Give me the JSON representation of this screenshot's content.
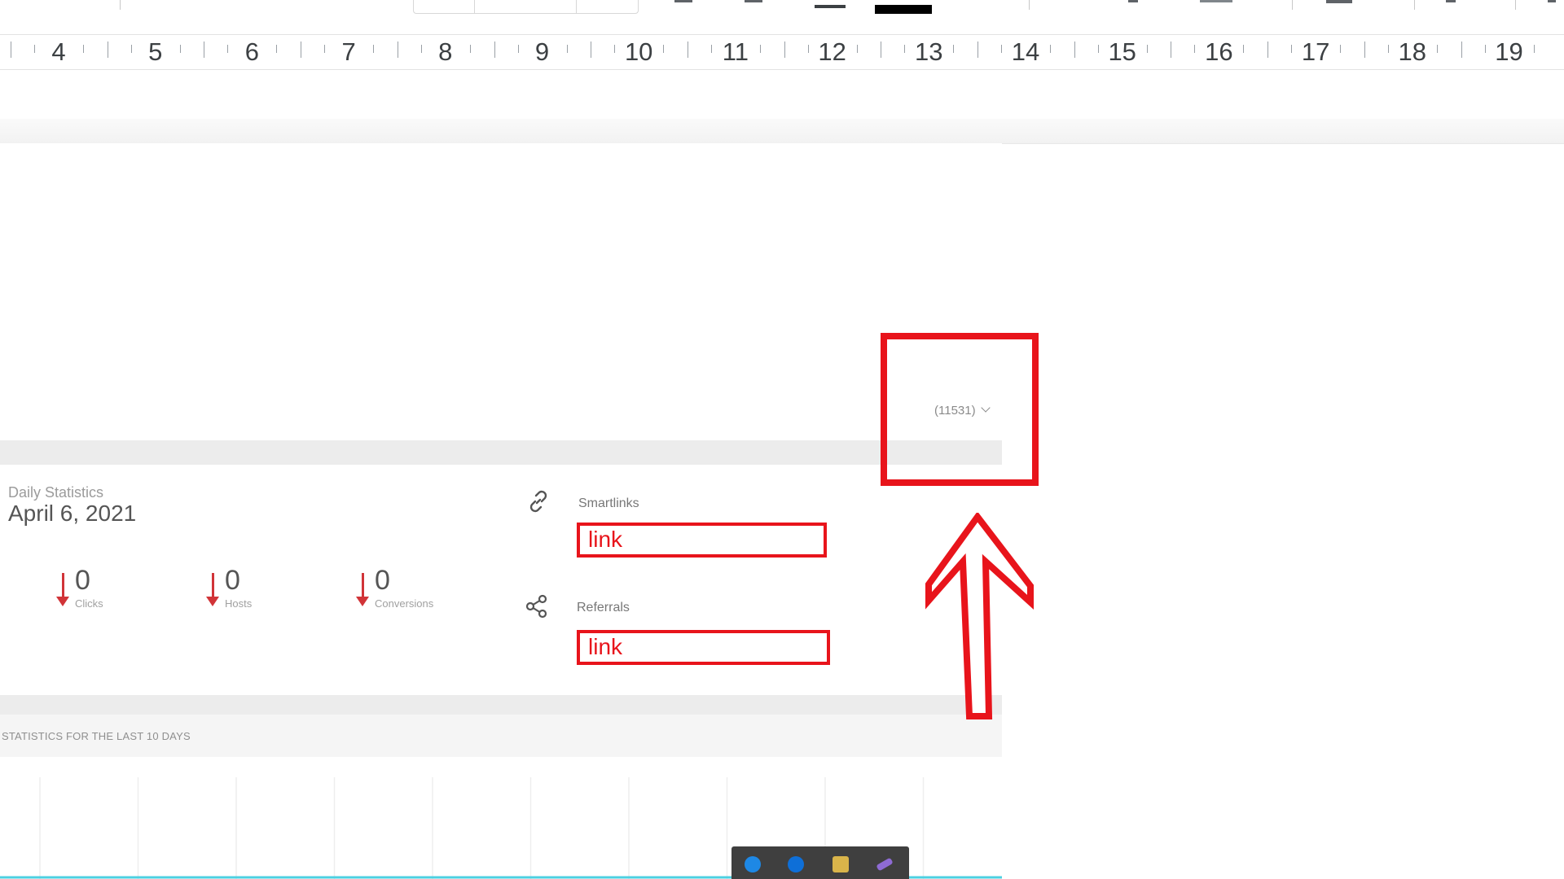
{
  "ruler": {
    "numbers": [
      "4",
      "5",
      "6",
      "7",
      "8",
      "9",
      "10",
      "11",
      "12",
      "13",
      "14",
      "15",
      "16",
      "17",
      "18",
      "19"
    ]
  },
  "dashboard": {
    "account_selector": "(11531)",
    "daily_stats": {
      "subtitle": "Daily Statistics",
      "date": "April 6, 2021"
    },
    "metrics": [
      {
        "value": "0",
        "label": "Clicks"
      },
      {
        "value": "0",
        "label": "Hosts"
      },
      {
        "value": "0",
        "label": "Conversions"
      }
    ],
    "smartlinks": {
      "label": "Smartlinks",
      "value": "link"
    },
    "referrals": {
      "label": "Referrals",
      "value": "link"
    },
    "chart_section_title": "STATISTICS FOR THE LAST 10 DAYS"
  },
  "colors": {
    "annotation": "#e8141b",
    "decline_arrow": "#d13438",
    "chart_line": "#4dd0e1"
  },
  "icons": [
    "link-icon",
    "share-icon",
    "bluetooth-icon",
    "teamviewer-icon",
    "security-icon",
    "feather-icon"
  ]
}
